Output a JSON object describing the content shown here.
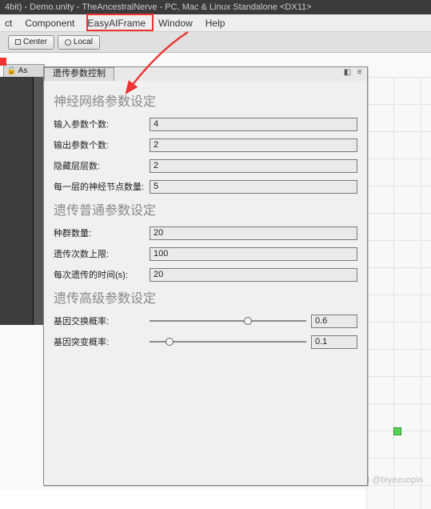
{
  "title_bar": "4bit) - Demo.unity - TheAncestralNerve - PC, Mac & Linux Standalone <DX11>",
  "menu": {
    "items": [
      "ct",
      "Component",
      "EasyAIFrame",
      "Window",
      "Help"
    ]
  },
  "toolbar": {
    "center": "Center",
    "local": "Local"
  },
  "asset_tab": "🔒 As",
  "panel": {
    "tab_label": "遗传参数控制",
    "sections": {
      "nn": {
        "title": "神经网络参数设定",
        "rows": [
          {
            "label": "输入参数个数:",
            "value": "4"
          },
          {
            "label": "输出参数个数:",
            "value": "2"
          },
          {
            "label": "隐藏层层数:",
            "value": "2"
          },
          {
            "label": "每一层的神经节点数量:",
            "value": "5"
          }
        ]
      },
      "ga": {
        "title": "遗传普通参数设定",
        "rows": [
          {
            "label": "种群数量:",
            "value": "20"
          },
          {
            "label": "遗传次数上限:",
            "value": "100"
          },
          {
            "label": "每次遗传的时间(s):",
            "value": "20"
          }
        ]
      },
      "adv": {
        "title": "遗传高级参数设定",
        "sliders": [
          {
            "label": "基因交换概率:",
            "value": "0.6",
            "pos": 0.6
          },
          {
            "label": "基因突变概率:",
            "value": "0.1",
            "pos": 0.1
          }
        ]
      }
    }
  },
  "watermark": "CSDN @biyezuopin"
}
